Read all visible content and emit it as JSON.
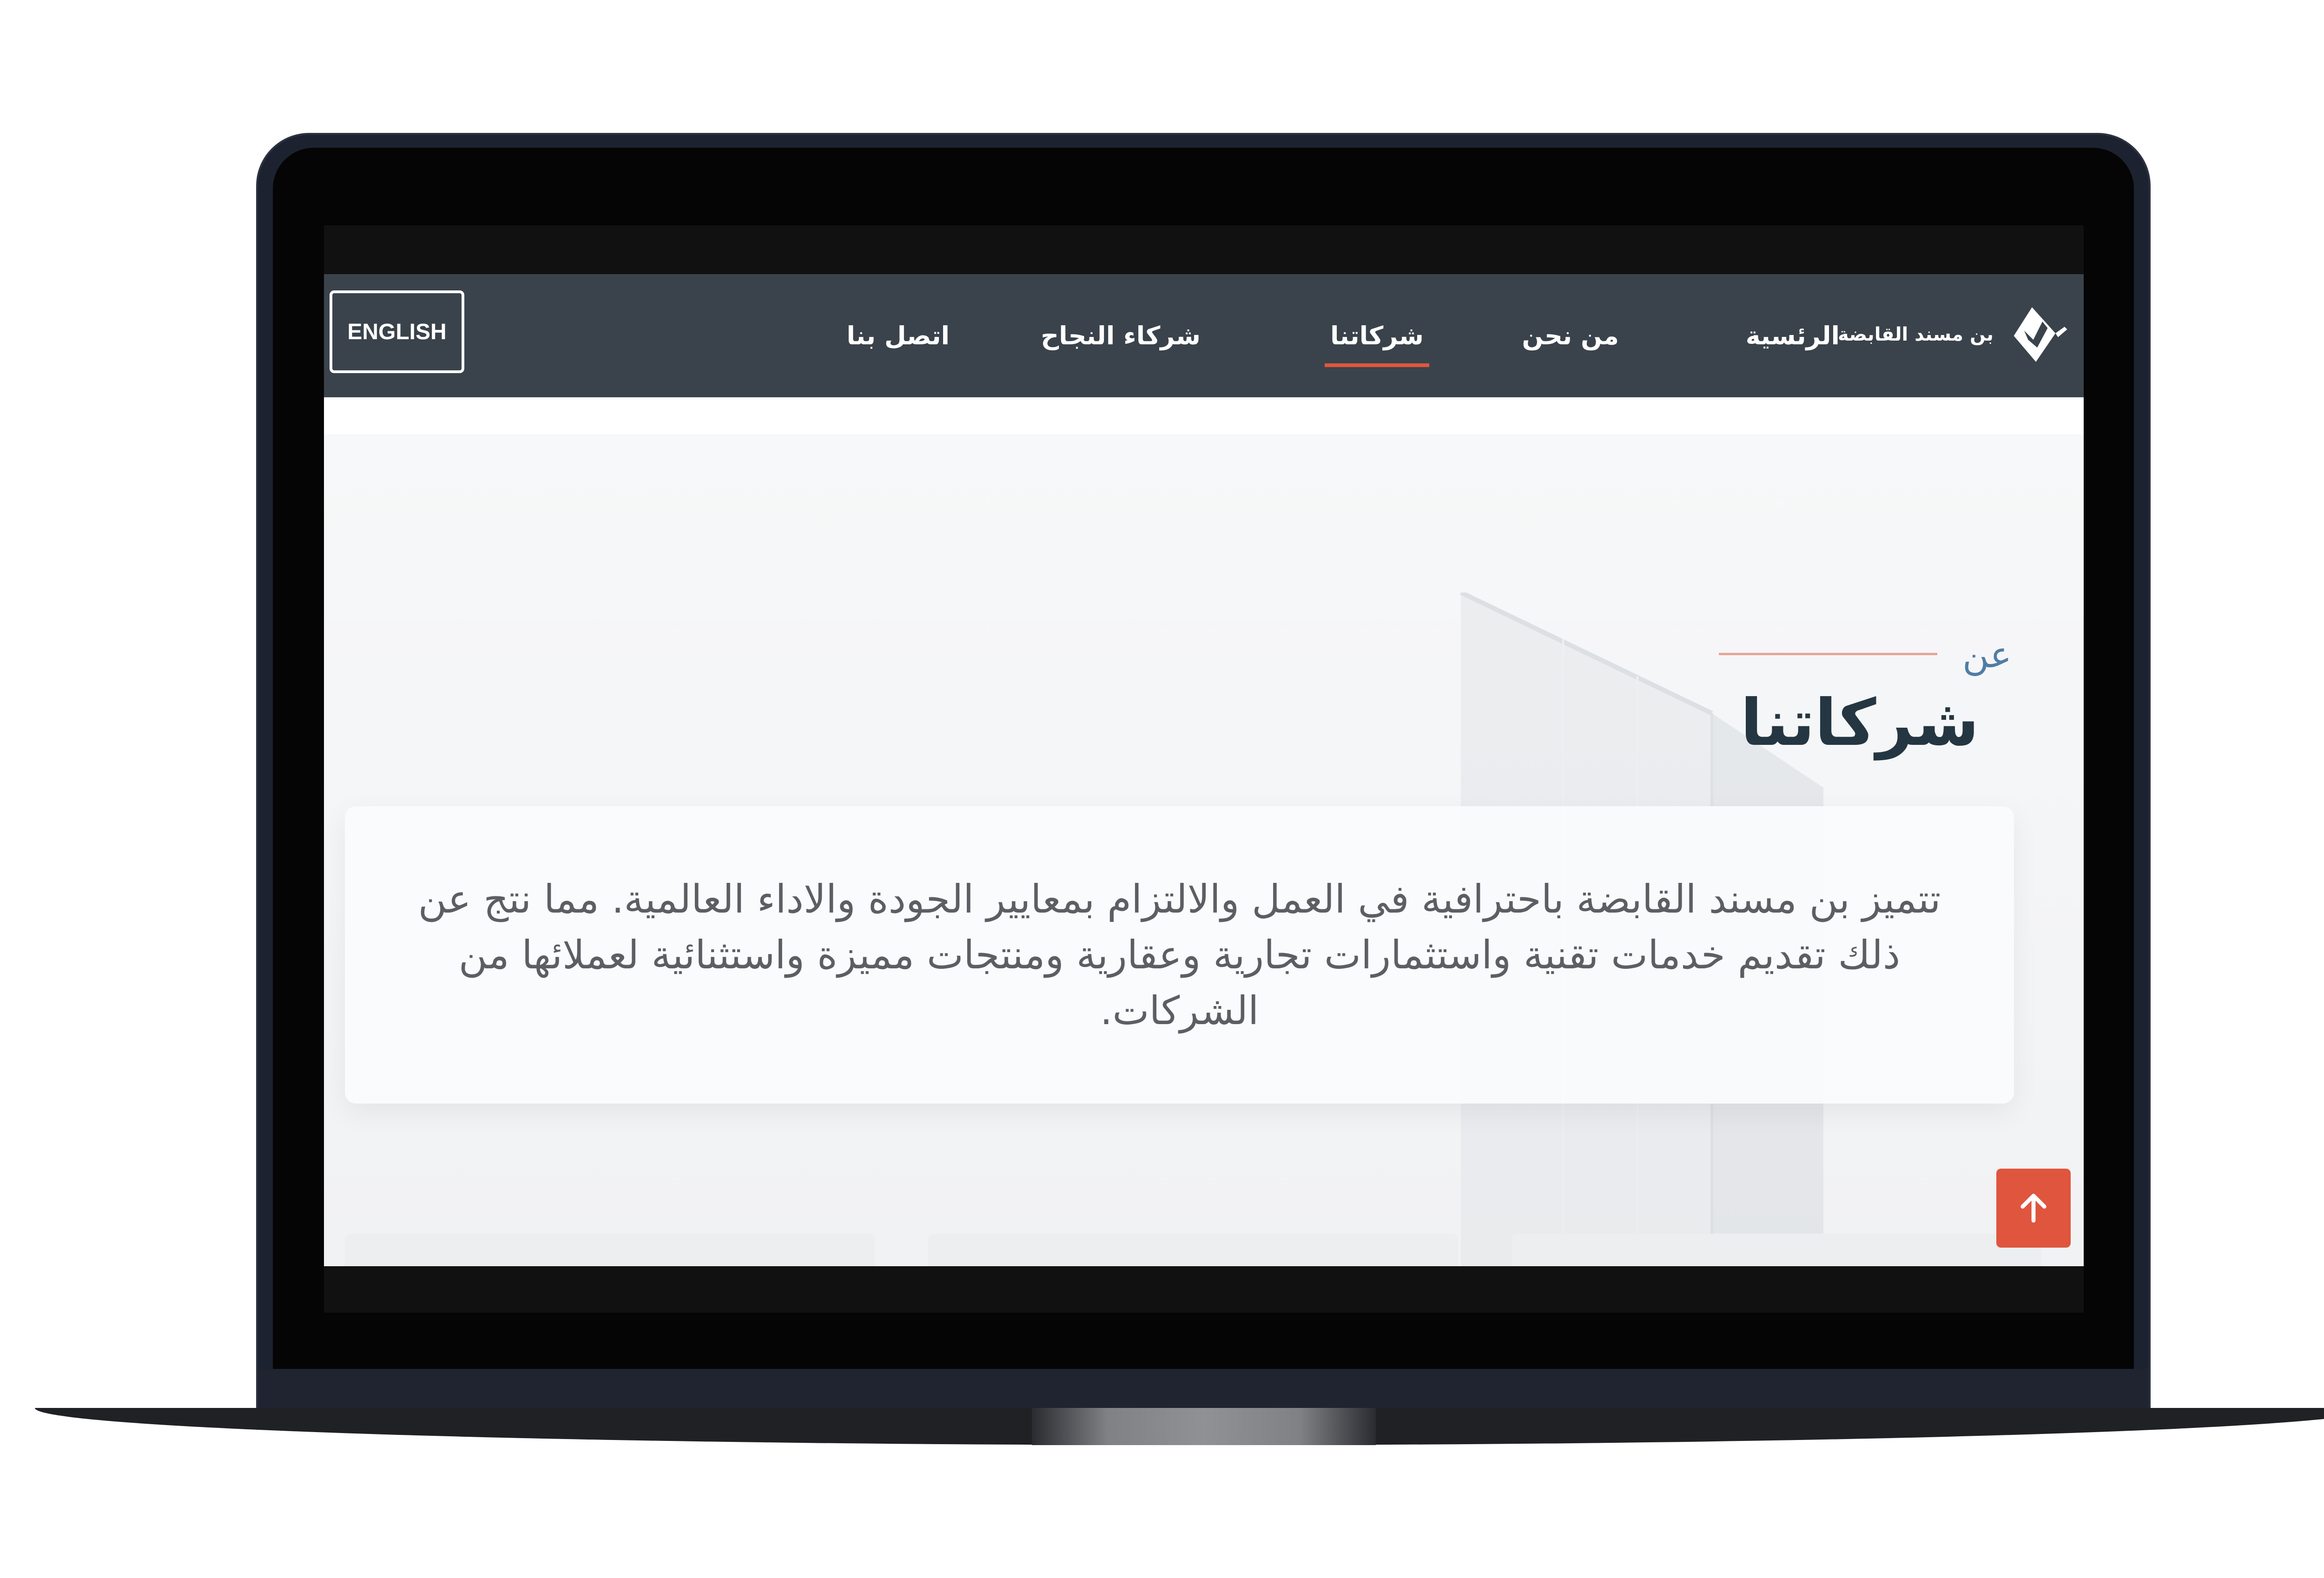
{
  "site": {
    "logo_text": "بن مسند القابضة"
  },
  "nav": {
    "items": [
      {
        "label": "الرئسية"
      },
      {
        "label": "من نحن"
      },
      {
        "label": "شركاتنا"
      },
      {
        "label": "شركاء النجاح"
      },
      {
        "label": "اتصل بنا"
      }
    ],
    "active_label": "شركاتنا",
    "language_button": "ENGLISH"
  },
  "hero": {
    "eyebrow": "عن",
    "title": "شركاتنا",
    "description": "تتميز بن مسند القابضة باحترافية في العمل والالتزام بمعايير الجودة والاداء العالمية. مما نتج عن ذلك تقديم خدمات تقنية واستثمارات تجارية وعقارية ومنتجات مميزة واستثنائية لعملائها من الشركات."
  },
  "colors": {
    "nav_background": "#3a434b",
    "accent": "#e0563d",
    "title_text": "#243641",
    "eyebrow_text": "#4f7da5"
  },
  "icons": {
    "logo": "bin-musnad-logo-icon",
    "scroll_top": "arrow-up-icon"
  }
}
